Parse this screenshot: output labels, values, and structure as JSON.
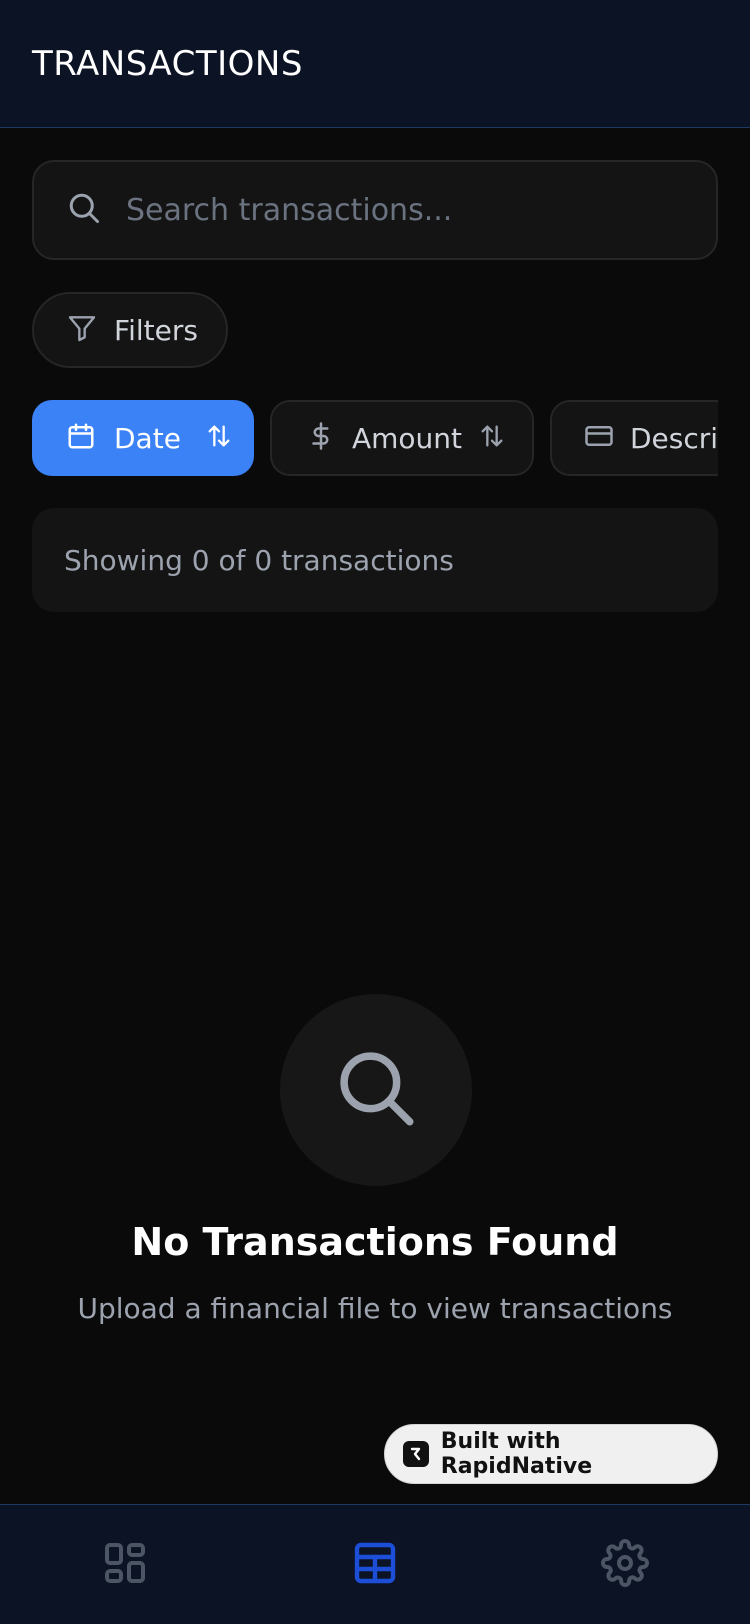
{
  "header": {
    "title": "TRANSACTIONS"
  },
  "search": {
    "placeholder": "Search transactions...",
    "value": ""
  },
  "filters": {
    "label": "Filters"
  },
  "sort_options": [
    {
      "label": "Date",
      "icon": "calendar-icon",
      "active": true
    },
    {
      "label": "Amount",
      "icon": "dollar-icon",
      "active": false
    },
    {
      "label": "Description",
      "icon": "credit-card-icon",
      "active": false
    }
  ],
  "summary": {
    "text": "Showing 0 of 0 transactions"
  },
  "empty_state": {
    "icon": "search-icon",
    "title": "No Transactions Found",
    "subtitle": "Upload a financial file to view transactions"
  },
  "badge": {
    "label": "Built with RapidNative"
  },
  "tabs": [
    {
      "icon": "dashboard-icon",
      "active": false
    },
    {
      "icon": "table-icon",
      "active": true
    },
    {
      "icon": "settings-icon",
      "active": false
    }
  ],
  "colors": {
    "accent": "#3b82f6",
    "active_tab": "#1d4ed8",
    "inactive_tab": "#4b5563",
    "background": "#0a0a0a",
    "header_bg": "#0b1324"
  }
}
